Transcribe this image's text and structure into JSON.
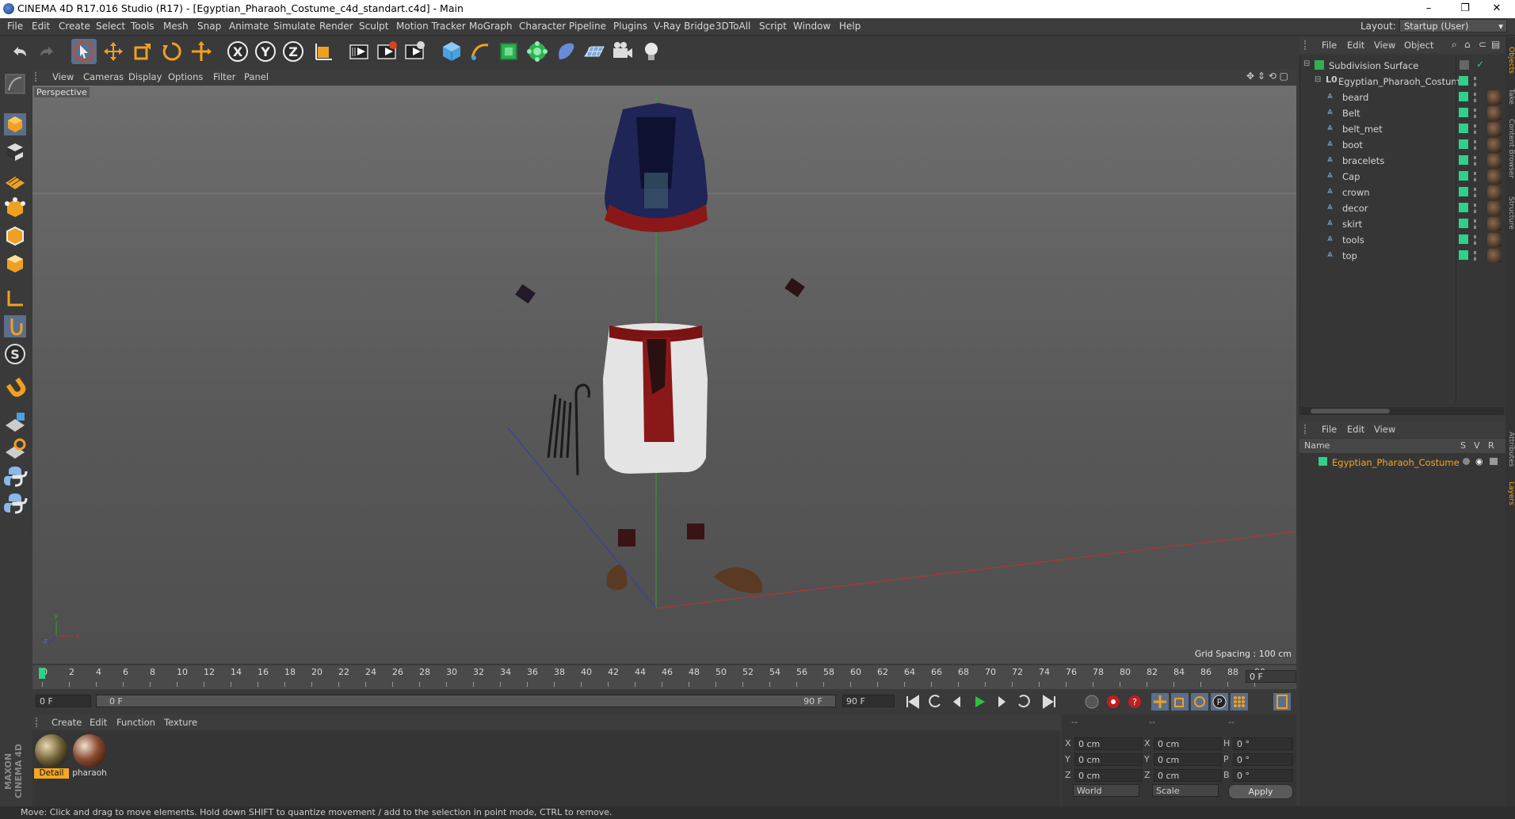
{
  "window": {
    "title": "CINEMA 4D R17.016 Studio (R17) - [Egyptian_Pharaoh_Costume_c4d_standart.c4d] - Main",
    "buttons": [
      "–",
      "❐",
      "✕"
    ]
  },
  "menu": [
    "File",
    "Edit",
    "Create",
    "Select",
    "Tools",
    "Mesh",
    "Snap",
    "Animate",
    "Simulate",
    "Render",
    "Sculpt",
    "Motion Tracker",
    "MoGraph",
    "Character",
    "Pipeline",
    "Plugins",
    "V-Ray Bridge",
    "3DToAll",
    "Script",
    "Window",
    "Help"
  ],
  "layout": {
    "label": "Layout:",
    "value": "Startup (User)"
  },
  "viewport": {
    "menu": [
      "View",
      "Cameras",
      "Display",
      "Options",
      "Filter",
      "Panel"
    ],
    "label": "Perspective",
    "grid_spacing": "Grid Spacing : 100 cm"
  },
  "timeline": {
    "ticks": [
      "0",
      "2",
      "4",
      "6",
      "8",
      "10",
      "12",
      "14",
      "16",
      "18",
      "20",
      "22",
      "24",
      "26",
      "28",
      "30",
      "32",
      "34",
      "36",
      "38",
      "40",
      "42",
      "44",
      "46",
      "48",
      "50",
      "52",
      "54",
      "56",
      "58",
      "60",
      "62",
      "64",
      "66",
      "68",
      "70",
      "72",
      "74",
      "76",
      "78",
      "80",
      "82",
      "84",
      "86",
      "88",
      "90"
    ],
    "current_frame": "0 F"
  },
  "transport": {
    "start_field": "0 F",
    "range_start": "0 F",
    "range_end": "90 F",
    "end_field": "90 F"
  },
  "materials": {
    "menu": [
      "Create",
      "Edit",
      "Function",
      "Texture"
    ],
    "items": [
      {
        "label": "Detail",
        "selected": true
      },
      {
        "label": "pharaoh",
        "selected": false
      }
    ]
  },
  "coordinates": {
    "headers": [
      "--",
      "--",
      "--"
    ],
    "rows": [
      {
        "a": "X",
        "av": "0 cm",
        "b": "X",
        "bv": "0 cm",
        "c": "H",
        "cv": "0 °"
      },
      {
        "a": "Y",
        "av": "0 cm",
        "b": "Y",
        "bv": "0 cm",
        "c": "P",
        "cv": "0 °"
      },
      {
        "a": "Z",
        "av": "0 cm",
        "b": "Z",
        "bv": "0 cm",
        "c": "B",
        "cv": "0 °"
      }
    ],
    "mode1": "World",
    "mode2": "Scale",
    "apply": "Apply"
  },
  "status": "Move: Click and drag to move elements. Hold down SHIFT to quantize movement / add to the selection in point mode, CTRL to remove.",
  "object_manager": {
    "menu": [
      "File",
      "Edit",
      "View",
      "Object"
    ],
    "root": "Subdivision Surface",
    "group": "Egyptian_Pharaoh_Costume",
    "children": [
      "beard",
      "Belt",
      "belt_met",
      "boot",
      "bracelets",
      "Cap",
      "crown",
      "decor",
      "skirt",
      "tools",
      "top"
    ]
  },
  "layer_manager": {
    "menu": [
      "File",
      "Edit",
      "View"
    ],
    "columns": [
      "Name",
      "S",
      "V",
      "R"
    ],
    "layers": [
      "Egyptian_Pharaoh_Costume"
    ]
  },
  "side_tabs": [
    "Objects",
    "Take",
    "Content Browser",
    "Structure",
    "Attributes",
    "Layers"
  ],
  "brand": "MAXON CINEMA 4D",
  "colors": {
    "accent": "#f5a623",
    "tag_green": "#2fd08a",
    "x_axis": "#c03030",
    "y_axis": "#30a030",
    "z_axis": "#3040b0"
  }
}
